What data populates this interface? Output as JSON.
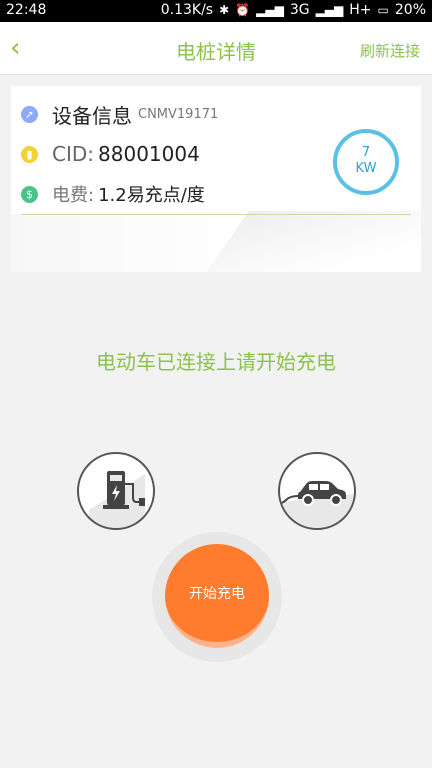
{
  "status_bar": {
    "time": "22:48",
    "net_speed": "0.13K/s",
    "network1": "3G",
    "network2": "H+",
    "battery": "20%"
  },
  "header": {
    "title": "电桩详情",
    "refresh_label": "刷新连接"
  },
  "device": {
    "info_label": "设备信息",
    "code": "CNMV19171",
    "cid_label": "CID:",
    "cid_value": "88001004",
    "fee_label": "电费:",
    "fee_value": "1.2易充点/度",
    "power_value": "7",
    "power_unit": "KW"
  },
  "message": "电动车已连接上请开始充电",
  "start_button": "开始充电",
  "colors": {
    "accent": "#8bc34a",
    "orange": "#ff7b2e",
    "blue": "#5bbfe8"
  },
  "icons": {
    "back": "chevron-left-icon",
    "info": "arrow-icon",
    "cid": "lock-icon",
    "fee": "dollar-icon",
    "charger": "charging-station-icon",
    "car": "car-icon"
  }
}
